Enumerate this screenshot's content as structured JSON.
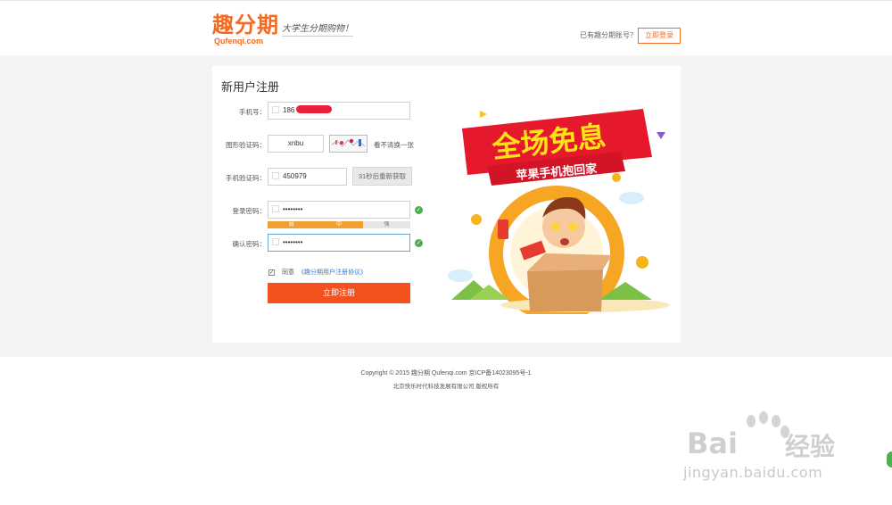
{
  "header": {
    "logo_cn": "趣分期",
    "logo_en": "Qufenqi.com",
    "slogan": "大学生分期购物！",
    "has_account": "已有趣分期账号？",
    "login_button": "立即登录"
  },
  "form": {
    "title": "新用户注册",
    "phone": {
      "label": "手机号：",
      "value": "186"
    },
    "captcha": {
      "label": "图形验证码：",
      "value": "xnbu",
      "refresh": "看不清换一张"
    },
    "sms": {
      "label": "手机验证码：",
      "value": "450979",
      "button": "31秒后重新获取"
    },
    "password": {
      "label": "登录密码：",
      "value": "••••••••"
    },
    "strength": {
      "weak": "弱",
      "medium": "中",
      "strong": "强",
      "colors": [
        "#f0a030",
        "#f0a030",
        "#cfcfcf"
      ]
    },
    "confirm": {
      "label": "确认密码：",
      "value": "••••••••"
    },
    "agree": {
      "text": "同意",
      "link": "《趣分期用户注册协议》",
      "checked": "✓"
    },
    "submit": "立即注册"
  },
  "promo": {
    "headline": "全场免息",
    "subline": "苹果手机抱回家"
  },
  "footer": {
    "line1": "Copyright © 2015 趣分期 Qufenqi.com 京ICP备14023095号-1",
    "line2": "北京快乐时代科技发展有限公司 版权所有"
  },
  "watermark": {
    "brand": "Bai",
    "brand2": "经验",
    "url": "jingyan.baidu.com"
  },
  "colors": {
    "accent": "#f36b21",
    "submit": "#f4511e",
    "check": "#4cae4c",
    "link": "#3a7cc4"
  }
}
